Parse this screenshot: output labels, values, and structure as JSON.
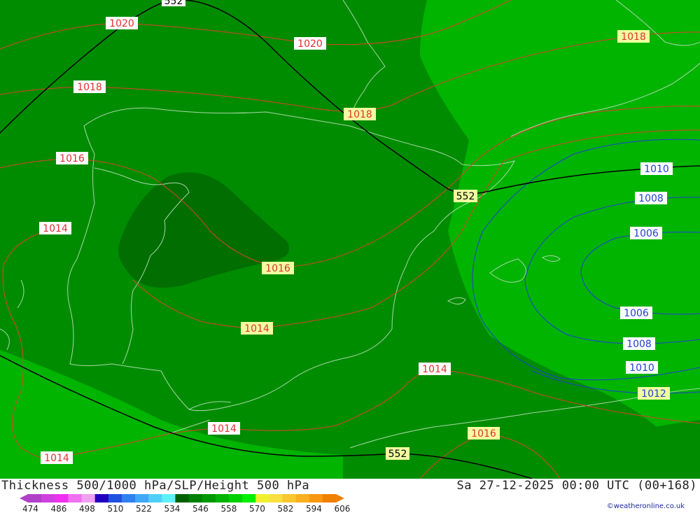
{
  "header": {
    "title_left": "Thickness 500/1000 hPa/SLP/Height 500 hPa",
    "title_right": "Sa 27-12-2025 00:00 UTC (00+168)"
  },
  "credit": "©weatheronline.co.uk",
  "legend": {
    "ticks": [
      "474",
      "486",
      "498",
      "510",
      "522",
      "534",
      "546",
      "558",
      "570",
      "582",
      "594",
      "606"
    ],
    "colors": [
      "#b040c8",
      "#d040e0",
      "#f030f0",
      "#f070f0",
      "#f0a0f0",
      "#2000c0",
      "#2050e0",
      "#3080f0",
      "#40a8f8",
      "#50d0f8",
      "#60f0f8",
      "#006000",
      "#008000",
      "#009800",
      "#00b400",
      "#00d000",
      "#00f000",
      "#f0f030",
      "#f8e040",
      "#f8c830",
      "#f8b020",
      "#f89810",
      "#f08000"
    ]
  },
  "map": {
    "colors": {
      "field_dark": "#006e00",
      "field_mid": "#008c00",
      "field_light": "#00b400",
      "isobar": "#e04030",
      "isobar_low": "#2040d0",
      "height": "#000000",
      "coast": "#a8d8a8"
    },
    "labels": {
      "slp_1020_a": "1020",
      "slp_1020_b": "1020",
      "slp_1018_a": "1018",
      "slp_1018_b": "1018",
      "slp_1018_c": "1018",
      "slp_1016_a": "1016",
      "slp_1016_b": "1016",
      "slp_1016_c": "1016",
      "slp_1014_a": "1014",
      "slp_1014_b": "1014",
      "slp_1014_c": "1014",
      "slp_1014_d": "1014",
      "slp_1014_e": "1014",
      "slp_1012": "1012",
      "slp_1010_a": "1010",
      "slp_1010_b": "1010",
      "slp_1008_a": "1008",
      "slp_1008_b": "1008",
      "slp_1006_a": "1006",
      "slp_1006_b": "1006",
      "height_552_top": "552",
      "height_552_mid": "552",
      "height_552_bottom": "552"
    }
  }
}
